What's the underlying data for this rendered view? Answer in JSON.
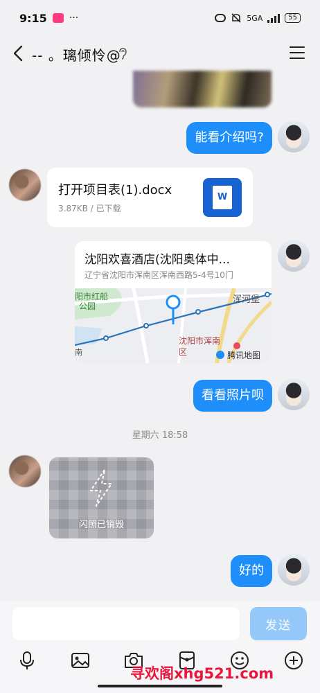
{
  "status_bar": {
    "time": "9:15",
    "more": "···",
    "network": "5GA",
    "battery": "55"
  },
  "header": {
    "title": "-- 。璃倾怜@"
  },
  "messages": {
    "me_1": "能看介绍吗?",
    "file": {
      "name": "打开项目表(1).docx",
      "meta": "3.87KB / 已下载",
      "icon_letter": "W"
    },
    "location": {
      "title": "沈阳欢喜酒店(沈阳奥体中...",
      "address": "辽宁省沈阳市浑南区浑南西路5-4号10门",
      "map_labels": {
        "park_line1": "阳市红船",
        "park_line2": "公园",
        "river_fort": "浑河堡",
        "district_line1": "沈阳市浑南",
        "district_line2": "区",
        "brand": "腾讯地图",
        "edge_char": "南"
      }
    },
    "me_2": "看看照片呗",
    "timestamp": "星期六 18:58",
    "flash_photo_label": "闪照已销毁",
    "me_3": "好的"
  },
  "input": {
    "placeholder": "",
    "send_label": "发送"
  },
  "watermark": "寻欢阁xhg521.com",
  "colors": {
    "accent": "#1e8efb",
    "send_disabled": "#94c8f8",
    "background": "#f1f1f3"
  }
}
